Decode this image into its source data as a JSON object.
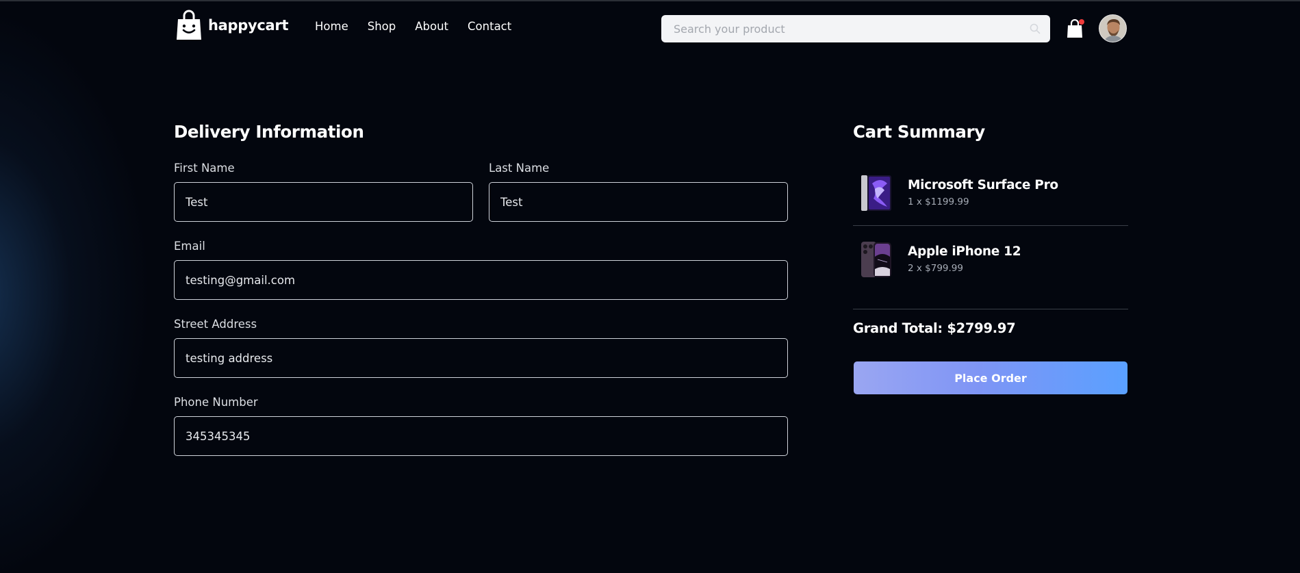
{
  "brand": {
    "name": "happycart"
  },
  "nav": [
    {
      "label": "Home"
    },
    {
      "label": "Shop"
    },
    {
      "label": "About"
    },
    {
      "label": "Contact"
    }
  ],
  "search": {
    "placeholder": "Search your product",
    "value": ""
  },
  "cart_badge": {
    "has_notification": true,
    "color": "#ef3b3b"
  },
  "delivery": {
    "title": "Delivery Information",
    "first_name": {
      "label": "First Name",
      "value": "Test"
    },
    "last_name": {
      "label": "Last Name",
      "value": "Test"
    },
    "email": {
      "label": "Email",
      "value": "testing@gmail.com"
    },
    "street": {
      "label": "Street Address",
      "value": "testing address"
    },
    "phone": {
      "label": "Phone Number",
      "value": "345345345"
    }
  },
  "cart_summary": {
    "title": "Cart Summary",
    "items": [
      {
        "name": "Microsoft Surface Pro",
        "qty_price": "1 x $1199.99",
        "image": "tablet-image"
      },
      {
        "name": "Apple iPhone 12",
        "qty_price": "2 x $799.99",
        "image": "phone-image"
      }
    ],
    "grand_total": "Grand Total: $2799.97",
    "button_label": "Place Order"
  },
  "colors": {
    "background": "#03060e",
    "button_gradient_start": "#9aa6f2",
    "button_gradient_end": "#5aa0ff",
    "input_border": "#cfd3da"
  }
}
